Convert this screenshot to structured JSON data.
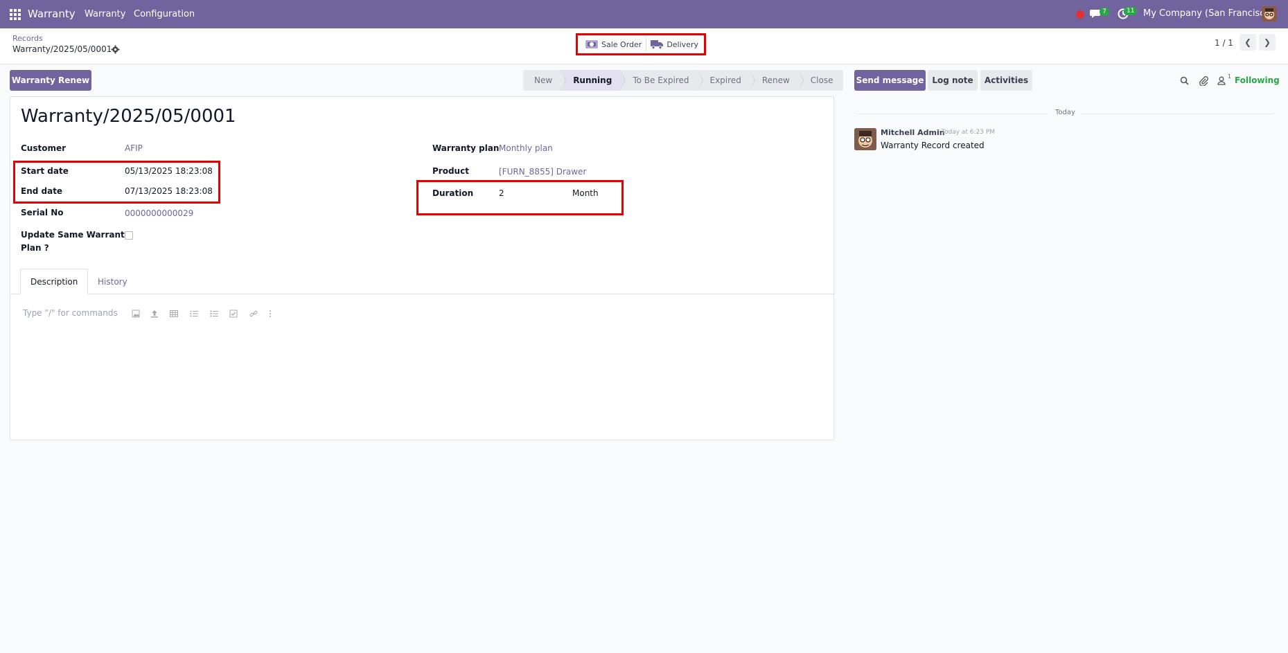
{
  "topnav": {
    "app_name": "Warranty",
    "menu": [
      "Warranty",
      "Configuration"
    ],
    "messages_count": "7",
    "activities_count": "11",
    "company": "My Company (San Francisco)"
  },
  "breadcrumb": {
    "parent": "Records",
    "current": "Warranty/2025/05/0001"
  },
  "smart_buttons": [
    "Sale Order",
    "Delivery"
  ],
  "pager": {
    "value": "1 / 1"
  },
  "actions": {
    "renew": "Warranty Renew"
  },
  "statusbar": [
    "New",
    "Running",
    "To Be Expired",
    "Expired",
    "Renew",
    "Close"
  ],
  "statusbar_active": "Running",
  "form": {
    "title": "Warranty/2025/05/0001",
    "customer_label": "Customer",
    "customer": "AFIP",
    "start_label": "Start date",
    "start": "05/13/2025 18:23:08",
    "end_label": "End date",
    "end": "07/13/2025 18:23:08",
    "serial_label": "Serial No",
    "serial": "0000000000029",
    "update_label_1": "Update Same Warranty",
    "update_label_2": "Plan ?",
    "plan_label": "Warranty plan",
    "plan": "Monthly plan",
    "product_label": "Product",
    "product": "[FURN_8855] Drawer",
    "duration_label": "Duration",
    "duration": "2",
    "duration_unit": "Month"
  },
  "tabs": [
    "Description",
    "History"
  ],
  "editor": {
    "placeholder": "Type \"/\" for commands"
  },
  "chatter": {
    "send_message": "Send message",
    "log_note": "Log note",
    "activities": "Activities",
    "followers_count": "1",
    "following": "Following",
    "date_separator": "Today",
    "author": "Mitchell Admin",
    "time": "Today at 6:23 PM",
    "body": "Warranty Record created"
  },
  "colors": {
    "brand": "#71639e",
    "highlight": "#e60000",
    "success": "#28a745"
  }
}
